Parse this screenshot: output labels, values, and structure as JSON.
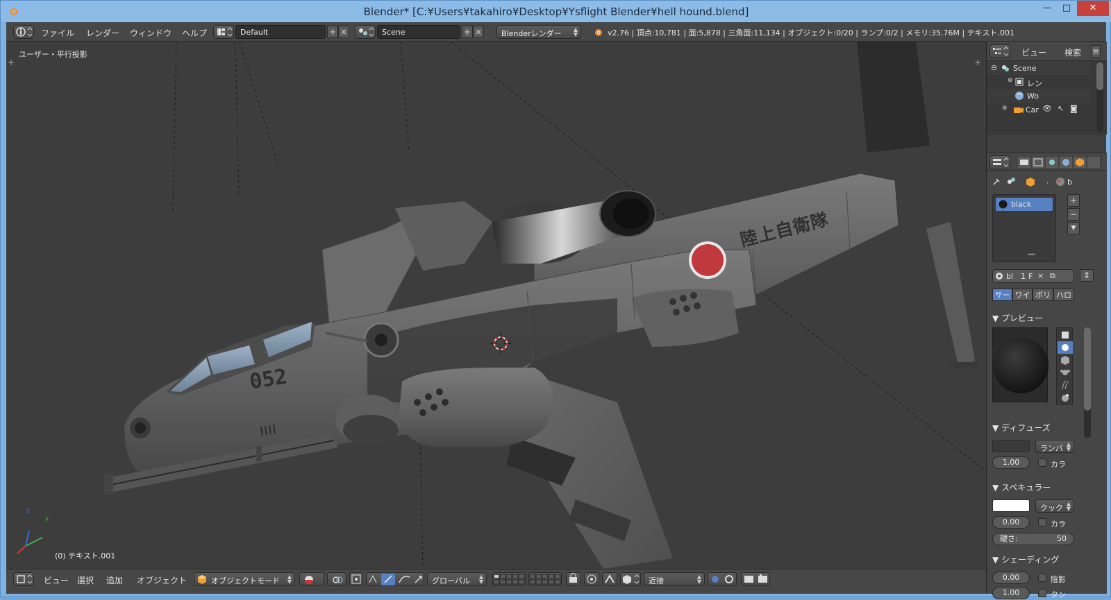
{
  "window": {
    "title": "Blender* [C:¥Users¥takahiro¥Desktop¥Ysflight Blender¥hell hound.blend]",
    "minimize_icon": "minimize-icon",
    "maximize_icon": "maximize-icon",
    "close_icon": "close-icon",
    "min_glyph": "—",
    "max_glyph": "□",
    "close_glyph": "✕"
  },
  "top_header": {
    "menus": [
      "ファイル",
      "レンダー",
      "ウィンドウ",
      "ヘルプ"
    ],
    "screen_layout": "Default",
    "scene": "Scene",
    "render_engine": "Blenderレンダー",
    "stats": "v2.76 | 頂点:10,781 | 面:5,878 | 三角面:11,134 | オブジェクト:0/20 | ランプ:0/2 | メモリ:35.76M | テキスト.001"
  },
  "viewport": {
    "view_label": "ユーザー・平行投影",
    "object_label": "(0) テキスト.001",
    "fuselage_text": "陸上自衛隊",
    "hull_number": "052",
    "axis_x": "x",
    "axis_y": "y",
    "axis_z": "z"
  },
  "bottom_header": {
    "menus": [
      "ビュー",
      "選択",
      "追加",
      "オブジェクト"
    ],
    "mode": "オブジェクトモード",
    "orientation": "グローバル",
    "snap_target": "近接"
  },
  "outliner": {
    "menus": [
      "ビュー",
      "検索"
    ],
    "items": [
      {
        "label": "Scene",
        "icon": "scene-icon"
      },
      {
        "label": "レン",
        "icon": "render-layers-icon"
      },
      {
        "label": "Wo",
        "icon": "world-icon"
      },
      {
        "label": "Car",
        "icon": "camera-icon"
      }
    ]
  },
  "properties": {
    "breadcrumb_tail": "b",
    "material_slot": "black",
    "id_name": "bl",
    "user_count": "1",
    "fake_user": "F",
    "tabs": [
      "サー",
      "ワイ",
      "ポリ",
      "ハロ"
    ],
    "active_tab": 0,
    "panels": {
      "preview": "プレビュー",
      "diffuse": "ディフューズ",
      "specular": "スペキュラー",
      "shading": "シェーディング"
    },
    "diffuse": {
      "shader": "ランバ",
      "intensity": "1.00",
      "ramp_label": "カラ"
    },
    "specular": {
      "shader": "クック",
      "intensity": "0.00",
      "ramp_label": "カラ",
      "hardness_label": "硬さ:",
      "hardness": "50"
    },
    "shading": {
      "emit": "0.00",
      "shadeless_label": "陰影",
      "ambient": "1.00",
      "tangent_label": "タン"
    }
  },
  "colors": {
    "viewport_bg": "#3d3d3d",
    "header_bg": "#474747",
    "model_gray": "#6e6e6e",
    "hinomaru_red": "#c0393d",
    "active_blue": "#5680c2",
    "window_frame": "#7fb2e0"
  }
}
